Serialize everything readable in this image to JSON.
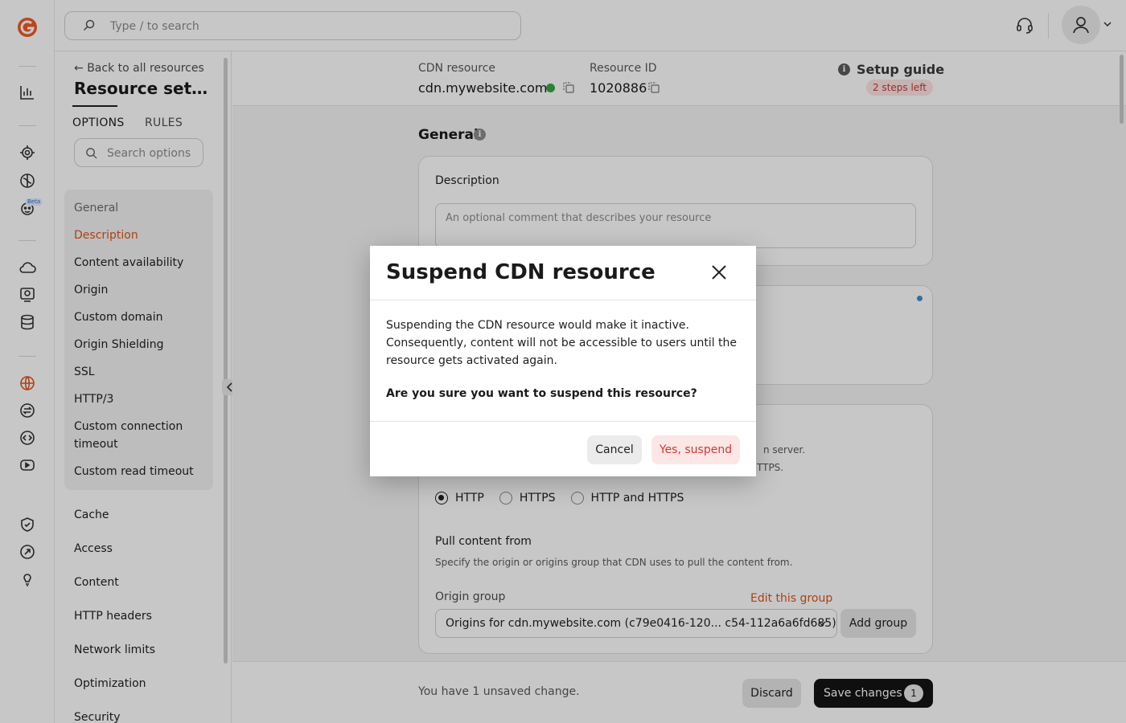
{
  "topbar": {
    "search_placeholder": "Type / to search"
  },
  "rail": {
    "beta_badge": "Beta",
    "icons": [
      "logo-icon",
      "stats-icon",
      "ai-chip-icon",
      "brain-icon",
      "robot-icon",
      "cloud-icon",
      "monitor-icon",
      "database-icon",
      "globe-icon",
      "transfer-icon",
      "code-icon",
      "video-icon",
      "shield-icon",
      "fire-icon",
      "lightbulb-icon"
    ]
  },
  "sidebar": {
    "back_label": "Back to all resources",
    "title": "Resource settin...",
    "tabs": [
      "OPTIONS",
      "RULES"
    ],
    "search_placeholder": "Search options",
    "group_items": [
      {
        "label": "General",
        "state": "head"
      },
      {
        "label": "Description",
        "state": "active"
      },
      {
        "label": "Content availability",
        "state": ""
      },
      {
        "label": "Origin",
        "state": ""
      },
      {
        "label": "Custom domain",
        "state": ""
      },
      {
        "label": "Origin Shielding",
        "state": ""
      },
      {
        "label": "SSL",
        "state": ""
      },
      {
        "label": "HTTP/3",
        "state": ""
      },
      {
        "label": "Custom connection timeout",
        "state": ""
      },
      {
        "label": "Custom read timeout",
        "state": ""
      }
    ],
    "other_items": [
      "Cache",
      "Access",
      "Content",
      "HTTP headers",
      "Network limits",
      "Optimization",
      "Security"
    ]
  },
  "resource": {
    "cdn_label": "CDN resource",
    "cdn_value": "cdn.mywebsite.com",
    "id_label": "Resource ID",
    "id_value": "1020886",
    "guide_label": "Setup guide",
    "steps_left": "2 steps left"
  },
  "general": {
    "title": "General",
    "description_label": "Description",
    "description_placeholder": "An optional comment that describes your resource",
    "partial_line_1": "n server.",
    "partial_line_2": "TTPS.",
    "protocols": [
      "HTTP",
      "HTTPS",
      "HTTP and HTTPS"
    ],
    "selected_protocol": "HTTP",
    "pull_title": "Pull content from",
    "pull_desc": "Specify the origin or origins group that CDN uses to pull the content from.",
    "origin_group_label": "Origin group",
    "edit_group_link": "Edit this group",
    "origin_group_value": "Origins for cdn.mywebsite.com (c79e0416-120... c54-112a6a6fd685)",
    "add_group_label": "Add group"
  },
  "footer": {
    "unsaved_text": "You have 1 unsaved change.",
    "discard_label": "Discard",
    "save_label": "Save changes",
    "save_count": "1"
  },
  "modal": {
    "title": "Suspend CDN resource",
    "body": "Suspending the CDN resource would make it inactive. Consequently, content will not be accessible to users until the resource gets activated again.",
    "question": "Are you sure you want to suspend this resource?",
    "cancel_label": "Cancel",
    "confirm_label": "Yes, suspend"
  },
  "colors": {
    "accent": "#e0521a",
    "status_active": "#3aa544",
    "danger_text": "#cf3b32"
  }
}
